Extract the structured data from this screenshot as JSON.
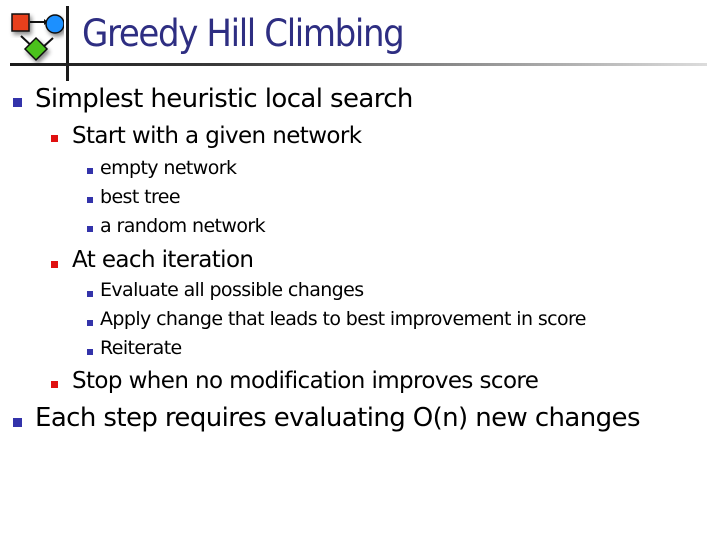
{
  "slide": {
    "title": "Greedy Hill Climbing",
    "logo_icon": "network-graph-icon",
    "colors": {
      "title": "#2e2e82",
      "bullet_level1": "#3333aa",
      "bullet_level2": "#e01010",
      "bullet_level3": "#3333aa"
    },
    "bullets": [
      {
        "text": "Simplest heuristic local search",
        "children": [
          {
            "text": "Start with a given network",
            "children": [
              "empty network",
              "best tree",
              "a random network"
            ]
          },
          {
            "text": "At each iteration",
            "children": [
              "Evaluate all possible changes",
              "Apply change that leads to best improvement in score",
              "Reiterate"
            ]
          },
          {
            "text": "Stop when no modification improves score",
            "children": []
          }
        ]
      },
      {
        "text": "Each step requires evaluating O(n) new changes",
        "children": []
      }
    ]
  }
}
